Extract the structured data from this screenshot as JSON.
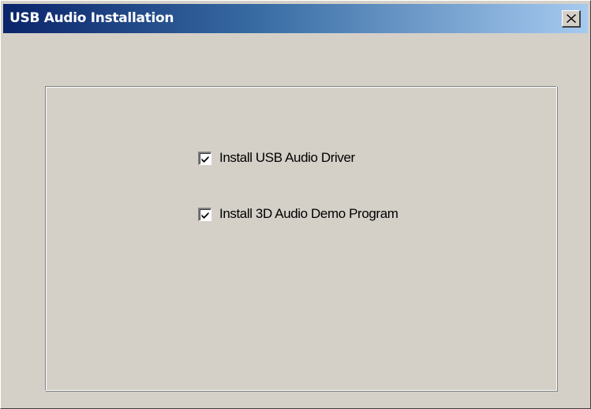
{
  "window": {
    "title": "USB Audio Installation",
    "close_glyph": "✕"
  },
  "options": [
    {
      "label": "Install USB Audio Driver",
      "checked": true
    },
    {
      "label": "Install 3D Audio Demo Program",
      "checked": true
    }
  ],
  "colors": {
    "titlebar_start": "#0a246a",
    "titlebar_end": "#a6caf0",
    "face": "#d4d0c8"
  },
  "icons": {
    "close": "close-icon",
    "check": "checkmark-icon"
  }
}
